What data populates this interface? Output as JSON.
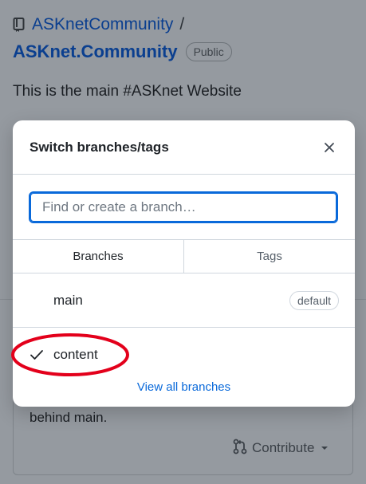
{
  "repo": {
    "owner": "ASKnetCommunity",
    "separator": "/",
    "name": "ASKnet.Community",
    "visibility": "Public",
    "description": "This is the main #ASKnet Website",
    "behind_text": "behind main.",
    "contribute_label": "Contribute"
  },
  "modal": {
    "title": "Switch branches/tags",
    "filter_placeholder": "Find or create a branch…",
    "tabs": [
      {
        "label": "Branches",
        "active": true
      },
      {
        "label": "Tags",
        "active": false
      }
    ],
    "branches": [
      {
        "name": "main",
        "badge": "default",
        "selected": false
      },
      {
        "name": "content",
        "badge": "",
        "selected": true
      }
    ],
    "view_all_label": "View all branches"
  },
  "colors": {
    "accent": "#0969da",
    "annotation": "#e3001b",
    "overlay": "#959aa0"
  },
  "icons": {
    "repo": "repo-icon",
    "close": "close-icon",
    "check": "check-icon",
    "contribute": "git-pull-request-icon",
    "dropdown": "triangle-down-icon"
  }
}
